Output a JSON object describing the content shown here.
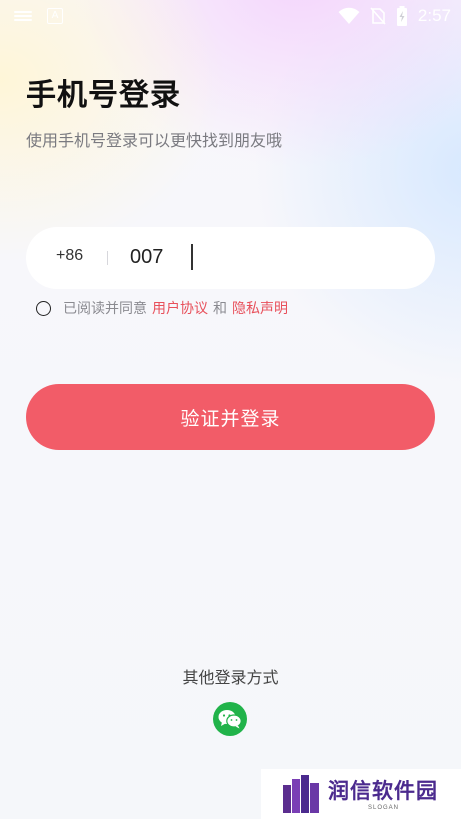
{
  "status_bar": {
    "time": "2:57",
    "notification_icon": "A",
    "icons": [
      "menu-lines-icon",
      "a-notification-icon",
      "wifi-icon",
      "no-sim-icon",
      "battery-charging-icon"
    ]
  },
  "header": {
    "title": "手机号登录",
    "subtitle": "使用手机号登录可以更快找到朋友哦"
  },
  "phone_form": {
    "country_code": "+86",
    "phone_value": "007"
  },
  "agreement": {
    "prefix": "已阅读并同意",
    "user_agreement": "用户协议",
    "conjunction": "和",
    "privacy_statement": "隐私声明",
    "checked": false
  },
  "submit": {
    "label": "验证并登录"
  },
  "other_login": {
    "label": "其他登录方式",
    "methods": [
      "wechat-icon"
    ]
  },
  "watermark": {
    "text": "润信软件园",
    "slogan": "SLOGAN"
  },
  "colors": {
    "accent": "#f25c68",
    "link": "#e8505b",
    "wechat": "#21b34a",
    "watermark": "#4b2a8e"
  }
}
